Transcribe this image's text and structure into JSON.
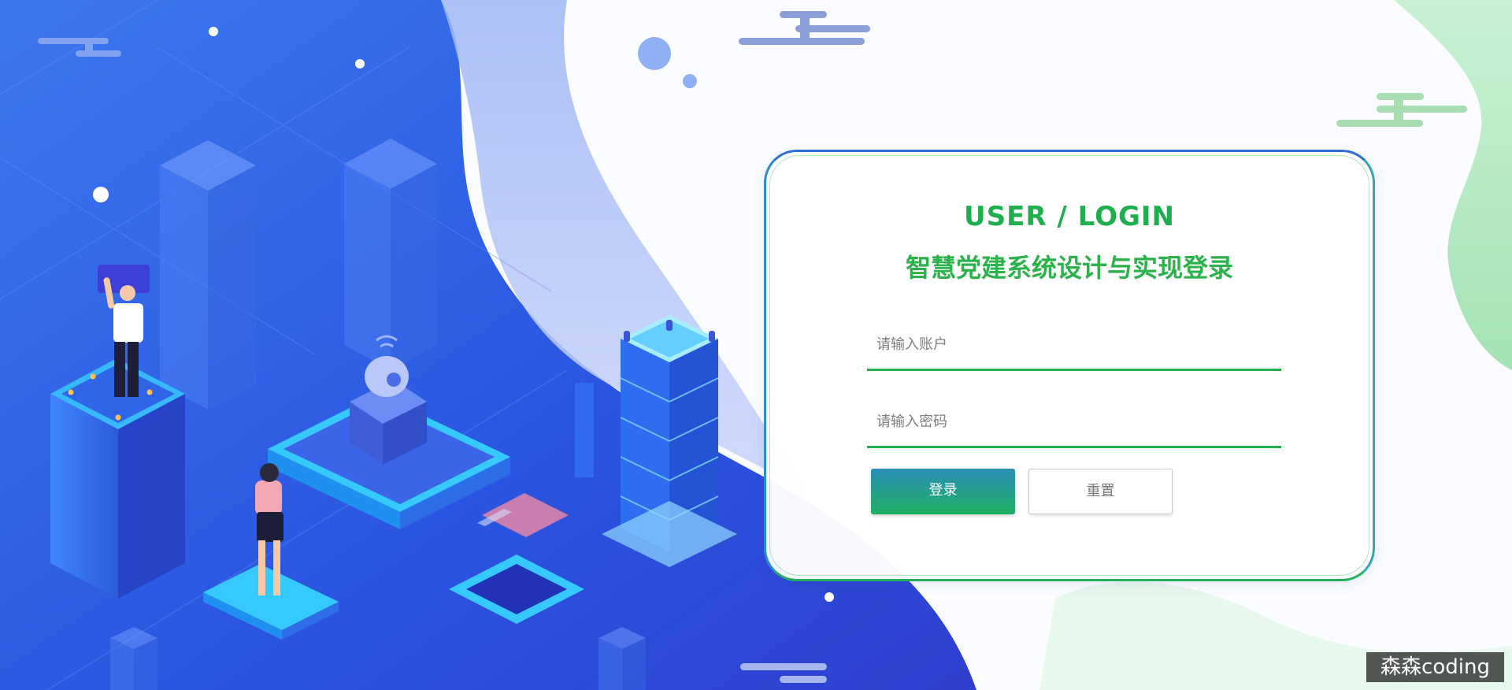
{
  "login": {
    "title": "USER / LOGIN",
    "subtitle": "智慧党建系统设计与实现登录",
    "account_placeholder": "请输入账户",
    "password_placeholder": "请输入密码",
    "login_label": "登录",
    "reset_label": "重置"
  },
  "watermark": {
    "text": "森森coding"
  },
  "colors": {
    "primary_blue": "#2b5fe6",
    "accent_green": "#1fae4e",
    "mint": "#a9e6b8"
  },
  "icons": [
    "cloud-icon",
    "server-tower-icon",
    "camera-dome-icon",
    "person-icon"
  ]
}
